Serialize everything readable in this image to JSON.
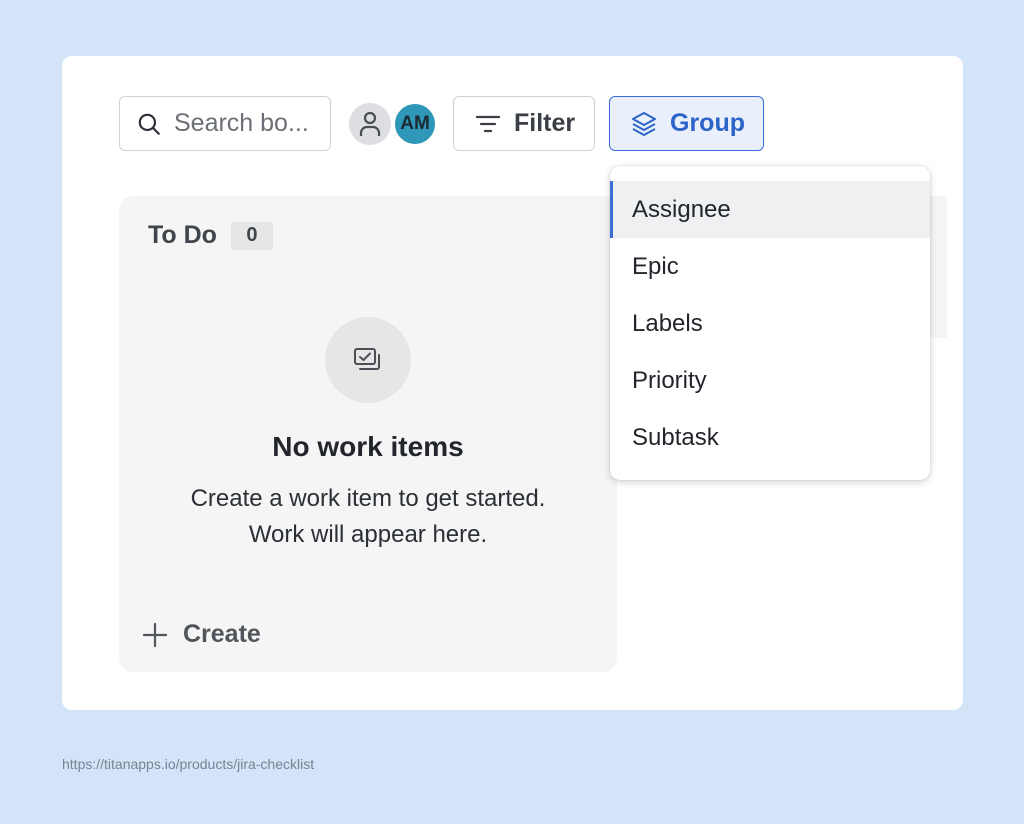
{
  "toolbar": {
    "search": {
      "placeholder": "Search bo...",
      "icon": "search-icon"
    },
    "avatars": [
      {
        "type": "unassigned",
        "icon": "person-icon"
      },
      {
        "type": "user",
        "initials": "AM",
        "color": "#2f97b8"
      }
    ],
    "filter_label": "Filter",
    "group_label": "Group"
  },
  "column": {
    "title": "To Do",
    "count": "0",
    "empty_title": "No work items",
    "empty_desc_line1": "Create a work item to get started.",
    "empty_desc_line2": "Work will appear here.",
    "create_label": "Create"
  },
  "group_menu": {
    "items": [
      {
        "label": "Assignee",
        "selected": true
      },
      {
        "label": "Epic",
        "selected": false
      },
      {
        "label": "Labels",
        "selected": false
      },
      {
        "label": "Priority",
        "selected": false
      },
      {
        "label": "Subtask",
        "selected": false
      }
    ]
  },
  "source_url": "https://titanapps.io/products/jira-checklist",
  "colors": {
    "background": "#d3e3f8",
    "accent": "#3b6fd4",
    "group_button_bg": "#e9f0fc",
    "column_bg": "#f5f5f5"
  }
}
